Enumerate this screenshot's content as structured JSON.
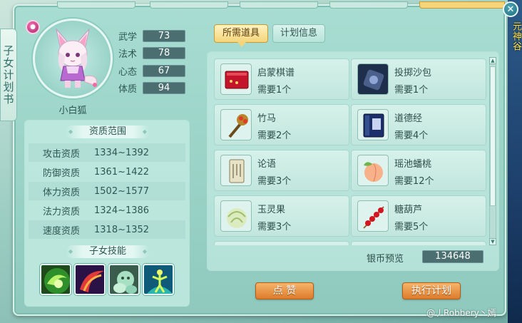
{
  "window": {
    "side_tab_title": "子女计划书",
    "close_symbol": "✕"
  },
  "child": {
    "name": "小白狐",
    "stats": [
      {
        "label": "武学",
        "value": "73"
      },
      {
        "label": "法术",
        "value": "78"
      },
      {
        "label": "心态",
        "value": "67"
      },
      {
        "label": "体质",
        "value": "94"
      }
    ]
  },
  "aptitude": {
    "title": "资质范围",
    "rows": [
      {
        "label": "攻击资质",
        "value": "1334~1392"
      },
      {
        "label": "防御资质",
        "value": "1361~1422"
      },
      {
        "label": "体力资质",
        "value": "1502~1577"
      },
      {
        "label": "法力资质",
        "value": "1324~1386"
      },
      {
        "label": "速度资质",
        "value": "1318~1352"
      }
    ]
  },
  "skills": {
    "title": "子女技能",
    "icons": [
      "green-swirl-skill-icon",
      "red-crescent-skill-icon",
      "ghost-spirit-skill-icon",
      "figure-energy-skill-icon"
    ]
  },
  "tabs": [
    {
      "label": "所需道具",
      "active": true
    },
    {
      "label": "计划信息",
      "active": false
    }
  ],
  "items": [
    {
      "name": "启蒙棋谱",
      "count": "需要1个",
      "icon": "red-book-icon"
    },
    {
      "name": "投掷沙包",
      "count": "需要1个",
      "icon": "sandbag-icon"
    },
    {
      "name": "竹马",
      "count": "需要2个",
      "icon": "bamboo-horse-icon"
    },
    {
      "name": "道德经",
      "count": "需要4个",
      "icon": "blue-book-icon"
    },
    {
      "name": "论语",
      "count": "需要3个",
      "icon": "scroll-book-icon"
    },
    {
      "name": "瑶池蟠桃",
      "count": "需要12个",
      "icon": "peach-icon"
    },
    {
      "name": "玉灵果",
      "count": "需要3个",
      "icon": "jade-fruit-icon"
    },
    {
      "name": "糖葫芦",
      "count": "需要5个",
      "icon": "candied-haws-icon"
    }
  ],
  "coins": {
    "label": "银币预览",
    "value": "134648"
  },
  "buttons": {
    "like": "点 赞",
    "execute": "执行计划"
  },
  "watermark": "@丿Robbery丶嫣",
  "background_right_text": "元神谷"
}
